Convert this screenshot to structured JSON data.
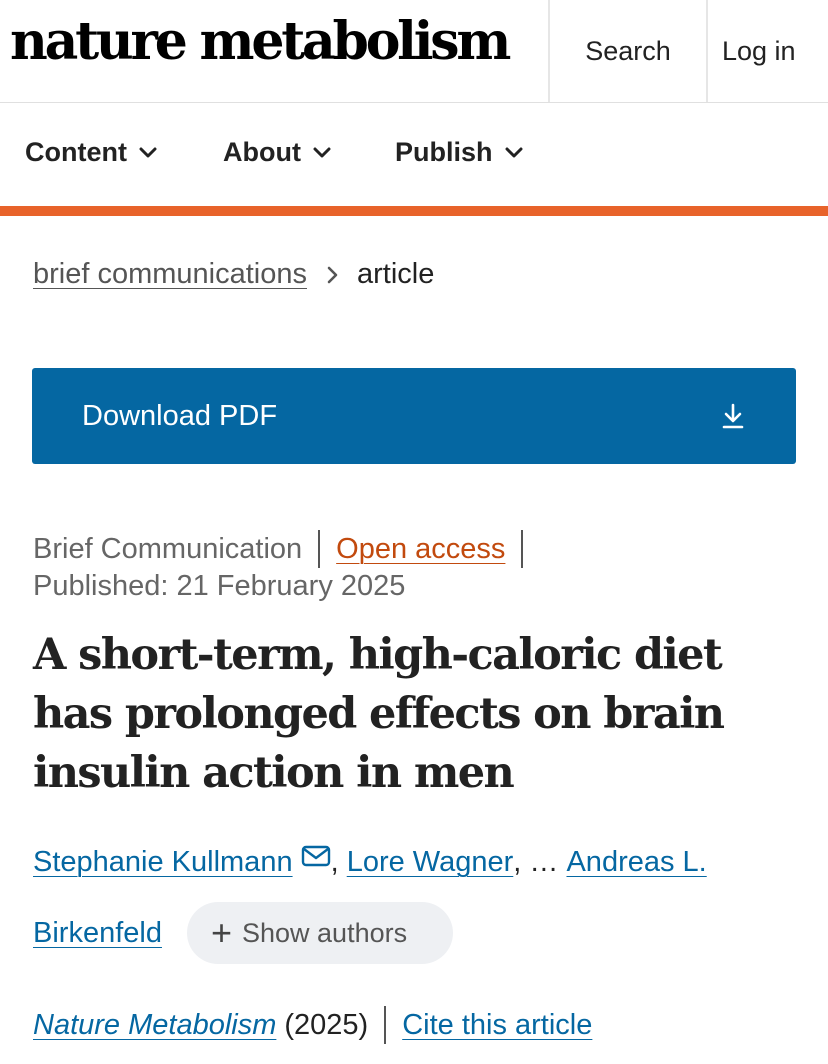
{
  "header": {
    "logo": "nature metabolism",
    "search_label": "Search",
    "login_label": "Log in"
  },
  "nav": {
    "items": [
      {
        "label": "Content",
        "icon": "chevron-down-icon"
      },
      {
        "label": "About",
        "icon": "chevron-down-icon"
      },
      {
        "label": "Publish",
        "icon": "chevron-down-icon"
      }
    ],
    "accent_color": "#e8632a"
  },
  "breadcrumb": {
    "parent": "brief communications",
    "current": "article"
  },
  "download": {
    "label": "Download PDF",
    "icon": "download-icon",
    "color": "#0567a2"
  },
  "article": {
    "type": "Brief Communication",
    "access": "Open access",
    "published": "Published: 21 February 2025",
    "title": "A short-term, high-caloric diet has prolonged effects on brain insulin action in men",
    "authors": {
      "first": "Stephanie Kullmann",
      "second": "Lore Wagner",
      "ellipsis": "…",
      "last_part1": "Andreas L.",
      "last_part2": "Birkenfeld",
      "show_authors_label": "Show authors"
    },
    "journal": "Nature Metabolism",
    "year": "(2025)",
    "cite_label": "Cite this article"
  },
  "colors": {
    "link": "#0567a2",
    "open_access": "#c24a0e"
  }
}
